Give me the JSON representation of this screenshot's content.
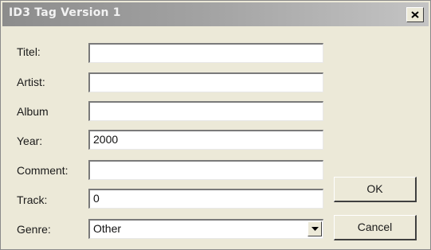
{
  "window": {
    "title": "ID3 Tag Version 1",
    "close_icon": "close-icon"
  },
  "fields": [
    {
      "label": "Titel:",
      "value": ""
    },
    {
      "label": "Artist:",
      "value": ""
    },
    {
      "label": "Album",
      "value": ""
    },
    {
      "label": "Year:",
      "value": "2000"
    },
    {
      "label": "Comment:",
      "value": ""
    },
    {
      "label": "Track:",
      "value": "0"
    }
  ],
  "genre": {
    "label": "Genre:",
    "selected": "Other",
    "dropdown_icon": "chevron-down-icon"
  },
  "buttons": {
    "ok": "OK",
    "cancel": "Cancel"
  }
}
